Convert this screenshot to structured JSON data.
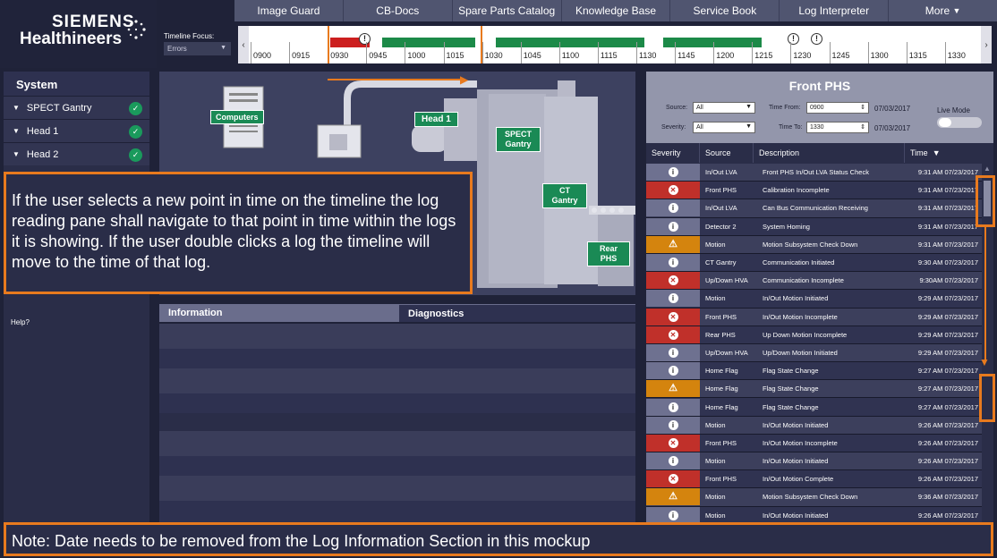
{
  "brand": {
    "line1": "SIEMENS",
    "line2": "Healthineers"
  },
  "nav": {
    "tabs": [
      "Image Guard",
      "CB-Docs",
      "Spare Parts Catalog",
      "Knowledge Base",
      "Service Book",
      "Log Interpreter",
      "More"
    ]
  },
  "timeline_focus": {
    "label": "Timeline Focus:",
    "value": "Errors"
  },
  "timeline": {
    "ticks": [
      "0900",
      "0915",
      "0930",
      "0945",
      "1000",
      "1015",
      "1030",
      "1045",
      "1100",
      "1115",
      "1130",
      "1145",
      "1200",
      "1215",
      "1230",
      "1245",
      "1300",
      "1315",
      "1330"
    ]
  },
  "sidebar": {
    "title": "System",
    "items": [
      {
        "label": "SPECT Gantry"
      },
      {
        "label": "Head 1"
      },
      {
        "label": "Head 2"
      }
    ],
    "help": "Help?"
  },
  "diagram": {
    "labels": {
      "computers": "Computers",
      "head1": "Head 1",
      "spect": "SPECT\nGantry",
      "ct": "CT\nGantry",
      "rear": "Rear\nPHS"
    }
  },
  "center_tabs": {
    "information": "Information",
    "diagnostics": "Diagnostics"
  },
  "log_pane": {
    "title": "Front PHS",
    "source_label": "Source:",
    "source_value": "All",
    "severity_label": "Severity:",
    "severity_value": "All",
    "time_from_label": "Time From:",
    "time_from_value": "0900",
    "time_to_label": "Time To:",
    "time_to_value": "1330",
    "date_from": "07/03/2017",
    "date_to": "07/03/2017",
    "live_mode": "Live Mode",
    "columns": {
      "severity": "Severity",
      "source": "Source",
      "description": "Description",
      "time": "Time"
    },
    "rows": [
      {
        "sev": "info",
        "source": "In/Out LVA",
        "desc": "Front PHS In/Out LVA Status Check",
        "time": "9:31 AM",
        "date": "07/23/2017"
      },
      {
        "sev": "err",
        "source": "Front PHS",
        "desc": "Calibration Incomplete",
        "time": "9:31 AM",
        "date": "07/23/2017"
      },
      {
        "sev": "info",
        "source": "In/Out LVA",
        "desc": "Can Bus Communication Receiving",
        "time": "9:31 AM",
        "date": "07/23/2017"
      },
      {
        "sev": "info",
        "source": "Detector 2",
        "desc": "System Homing",
        "time": "9:31 AM",
        "date": "07/23/2017"
      },
      {
        "sev": "warn",
        "source": "Motion",
        "desc": "Motion Subsystem Check Down",
        "time": "9:31 AM",
        "date": "07/23/2017"
      },
      {
        "sev": "info",
        "source": "CT Gantry",
        "desc": "Communication Initiated",
        "time": "9:30 AM",
        "date": "07/23/2017"
      },
      {
        "sev": "err",
        "source": "Up/Down HVA",
        "desc": "Communication Incomplete",
        "time": "9:30AM",
        "date": "07/23/2017"
      },
      {
        "sev": "info",
        "source": "Motion",
        "desc": "In/Out Motion Initiated",
        "time": "9:29 AM",
        "date": "07/23/2017"
      },
      {
        "sev": "err",
        "source": "Front PHS",
        "desc": "In/Out Motion Incomplete",
        "time": "9:29 AM",
        "date": "07/23/2017"
      },
      {
        "sev": "err",
        "source": "Rear PHS",
        "desc": "Up Down Motion Incomplete",
        "time": "9:29 AM",
        "date": "07/23/2017"
      },
      {
        "sev": "info",
        "source": "Up/Down HVA",
        "desc": "Up/Down Motion Initiated",
        "time": "9:29 AM",
        "date": "07/23/2017"
      },
      {
        "sev": "info",
        "source": "Home Flag",
        "desc": "Flag State Change",
        "time": "9:27 AM",
        "date": "07/23/2017"
      },
      {
        "sev": "warn",
        "source": "Home Flag",
        "desc": "Flag State Change",
        "time": "9:27 AM",
        "date": "07/23/2017"
      },
      {
        "sev": "info",
        "source": "Home Flag",
        "desc": "Flag State Change",
        "time": "9:27 AM",
        "date": "07/23/2017"
      },
      {
        "sev": "info",
        "source": "Motion",
        "desc": "In/Out Motion Initiated",
        "time": "9:26 AM",
        "date": "07/23/2017"
      },
      {
        "sev": "err",
        "source": "Front PHS",
        "desc": "In/Out Motion Incomplete",
        "time": "9:26 AM",
        "date": "07/23/2017"
      },
      {
        "sev": "info",
        "source": "Motion",
        "desc": "In/Out Motion Initiated",
        "time": "9:26 AM",
        "date": "07/23/2017"
      },
      {
        "sev": "err",
        "source": "Front PHS",
        "desc": "In/Out Motion Complete",
        "time": "9:26 AM",
        "date": "07/23/2017"
      },
      {
        "sev": "warn",
        "source": "Motion",
        "desc": "Motion Subsystem Check Down",
        "time": "9:36 AM",
        "date": "07/23/2017"
      },
      {
        "sev": "info",
        "source": "Motion",
        "desc": "In/Out Motion Initiated",
        "time": "9:26 AM",
        "date": "07/23/2017"
      }
    ]
  },
  "annotations": {
    "callout": "If the user selects a new point in time on the timeline the log reading pane shall navigate to that point in time within the logs it is showing. If the user double clicks a log the timeline will move to the time of that log.",
    "note": "Note: Date needs to be removed from the Log Information Section in this mockup"
  },
  "colors": {
    "accent": "#e87a1e",
    "ok": "#1a9a5c",
    "error": "#c0302a",
    "warning": "#d4840e",
    "label_green": "#1a8a55"
  }
}
